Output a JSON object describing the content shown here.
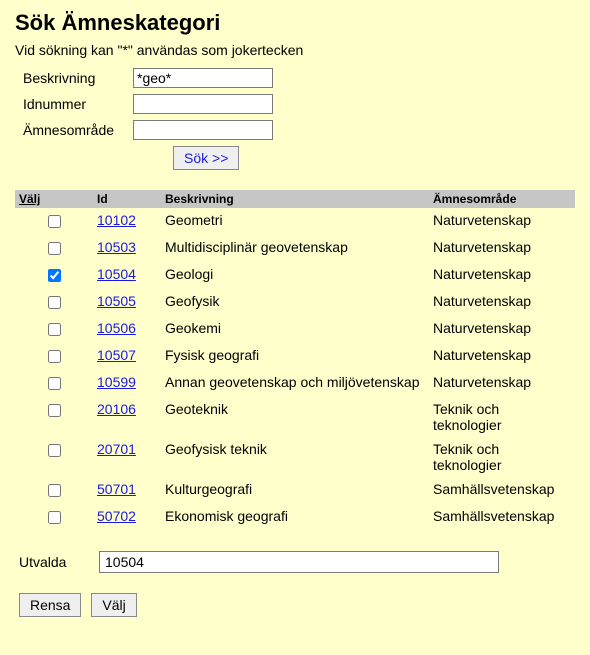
{
  "title": "Sök Ämneskategori",
  "hint": "Vid sökning kan \"*\" användas som jokertecken",
  "search": {
    "beskrivning_label": "Beskrivning",
    "beskrivning_value": "*geo*",
    "idnummer_label": "Idnummer",
    "idnummer_value": "",
    "amnesomrade_label": "Ämnesområde",
    "amnesomrade_value": "",
    "search_button": "Sök >>"
  },
  "columns": {
    "valj": "Välj",
    "id": "Id",
    "beskrivning": "Beskrivning",
    "amnesomrade": "Ämnesområde"
  },
  "rows": [
    {
      "checked": false,
      "id": "10102",
      "beskrivning": "Geometri",
      "amnesomrade": "Naturvetenskap"
    },
    {
      "checked": false,
      "id": "10503",
      "beskrivning": "Multidisciplinär geovetenskap",
      "amnesomrade": "Naturvetenskap"
    },
    {
      "checked": true,
      "id": "10504",
      "beskrivning": "Geologi",
      "amnesomrade": "Naturvetenskap"
    },
    {
      "checked": false,
      "id": "10505",
      "beskrivning": "Geofysik",
      "amnesomrade": "Naturvetenskap"
    },
    {
      "checked": false,
      "id": "10506",
      "beskrivning": "Geokemi",
      "amnesomrade": "Naturvetenskap"
    },
    {
      "checked": false,
      "id": "10507",
      "beskrivning": "Fysisk geografi",
      "amnesomrade": "Naturvetenskap"
    },
    {
      "checked": false,
      "id": "10599",
      "beskrivning": "Annan geovetenskap och miljövetenskap",
      "amnesomrade": "Naturvetenskap"
    },
    {
      "checked": false,
      "id": "20106",
      "beskrivning": "Geoteknik",
      "amnesomrade": "Teknik och teknologier"
    },
    {
      "checked": false,
      "id": "20701",
      "beskrivning": "Geofysisk teknik",
      "amnesomrade": "Teknik och teknologier"
    },
    {
      "checked": false,
      "id": "50701",
      "beskrivning": "Kulturgeografi",
      "amnesomrade": "Samhällsvetenskap"
    },
    {
      "checked": false,
      "id": "50702",
      "beskrivning": "Ekonomisk geografi",
      "amnesomrade": "Samhällsvetenskap"
    }
  ],
  "selected": {
    "label": "Utvalda",
    "value": "10504"
  },
  "buttons": {
    "rensa": "Rensa",
    "valj": "Välj"
  }
}
